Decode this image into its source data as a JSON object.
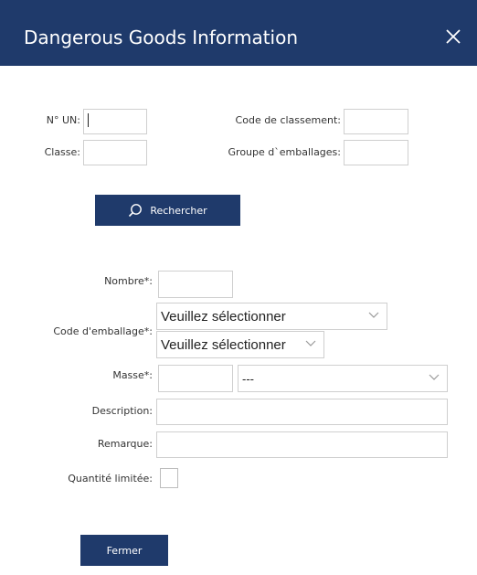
{
  "dialog": {
    "title": "Dangerous Goods Information",
    "close_icon": "close-icon"
  },
  "search": {
    "un_label": "N° UN:",
    "un_value": "",
    "classification_label": "Code de classement:",
    "classification_value": "",
    "class_label": "Classe:",
    "class_value": "",
    "packing_group_label": "Groupe d`emballages:",
    "packing_group_value": "",
    "search_button_label": "Rechercher",
    "search_icon": "search-icon"
  },
  "details": {
    "number_label": "Nombre*:",
    "number_value": "",
    "packaging_code_label": "Code d'emballage*:",
    "packaging_code_select_1": "Veuillez sélectionner",
    "packaging_code_select_2": "Veuillez sélectionner",
    "mass_label": "Masse*:",
    "mass_value": "",
    "mass_unit_select": "---",
    "description_label": "Description:",
    "description_value": "",
    "remark_label": "Remarque:",
    "remark_value": "",
    "limited_quantity_label": "Quantité limitée:",
    "limited_quantity_checked": false
  },
  "footer": {
    "close_button_label": "Fermer"
  },
  "colors": {
    "header_bg": "#1f3a6b",
    "button_bg": "#1f3a6b",
    "border": "#cfcfcf"
  }
}
